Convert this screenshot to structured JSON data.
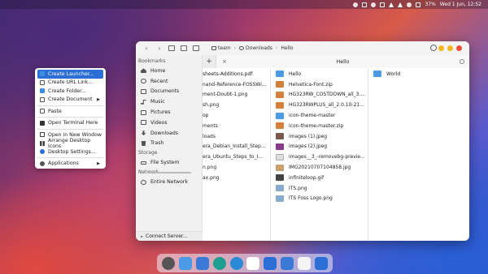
{
  "topbar": {
    "battery": "37%",
    "clock": "Wed 1 Jun, 12:52"
  },
  "context_menu": {
    "items": [
      {
        "label": "Create Launcher...",
        "icon": "folder-icon",
        "active": true
      },
      {
        "label": "Create URL Link...",
        "icon": "link-icon"
      },
      {
        "label": "Create Folder...",
        "icon": "folder-icon"
      },
      {
        "label": "Create Document",
        "icon": "document-icon",
        "submenu": true
      },
      {
        "separator": true
      },
      {
        "label": "Paste",
        "icon": "paste-icon"
      },
      {
        "separator": true
      },
      {
        "label": "Open Terminal Here",
        "icon": "terminal-icon"
      },
      {
        "separator": true
      },
      {
        "label": "Open in New Window",
        "icon": "window-icon"
      },
      {
        "label": "Arrange Desktop Icons",
        "icon": "grid-icon"
      },
      {
        "label": "Desktop Settings...",
        "icon": "settings-icon"
      },
      {
        "separator": true
      },
      {
        "label": "Applications",
        "icon": "apps-icon",
        "submenu": true
      }
    ]
  },
  "file_manager": {
    "breadcrumb": [
      "team",
      "Downloads",
      "Hello"
    ],
    "tab_title": "Hello",
    "sidebar": {
      "bookmarks_header": "Bookmarks",
      "bookmarks": [
        "Home",
        "Recent",
        "Documents",
        "Music",
        "Pictures",
        "Videos",
        "Downloads",
        "Trash"
      ],
      "storage_header": "Storage",
      "storage": [
        "File System"
      ],
      "network_header": "Network",
      "network": [
        "Entire Network"
      ],
      "connect_server": "Connect Server..."
    },
    "column1": [
      "sheets-Additions.pdf",
      "nand-Reference-FOSSWi...",
      "ment-Doubt-1.png",
      "sh.png",
      "op",
      "ments",
      "loads",
      "era_Debian_Install_Step...",
      "era_Ubuntu_Steps_to_I...",
      "n.png",
      "ax.png"
    ],
    "column2": [
      {
        "name": "Hello",
        "type": "folder"
      },
      {
        "name": "Helvetica-Font.zip",
        "type": "zip"
      },
      {
        "name": "HG323RW_COSTDOWN_all_3....",
        "type": "zip"
      },
      {
        "name": "HG323RWPLUS_all_2.0.10-21...",
        "type": "zip"
      },
      {
        "name": "icon-theme-master",
        "type": "folder"
      },
      {
        "name": "icon-theme-master.zip",
        "type": "zip"
      },
      {
        "name": "images (1).jpeg",
        "type": "img2"
      },
      {
        "name": "images (2).jpeg",
        "type": "imgpurple"
      },
      {
        "name": "images__3_-removebg-previe...",
        "type": "imgsm"
      },
      {
        "name": "IMG20210707104858.jpg",
        "type": "jpg"
      },
      {
        "name": "infiniteloop.gif",
        "type": "imgbw"
      },
      {
        "name": "ITS.png",
        "type": "its"
      },
      {
        "name": "ITS Foss Logo.png",
        "type": "its"
      }
    ],
    "column3": [
      {
        "name": "World",
        "type": "folder"
      }
    ]
  }
}
